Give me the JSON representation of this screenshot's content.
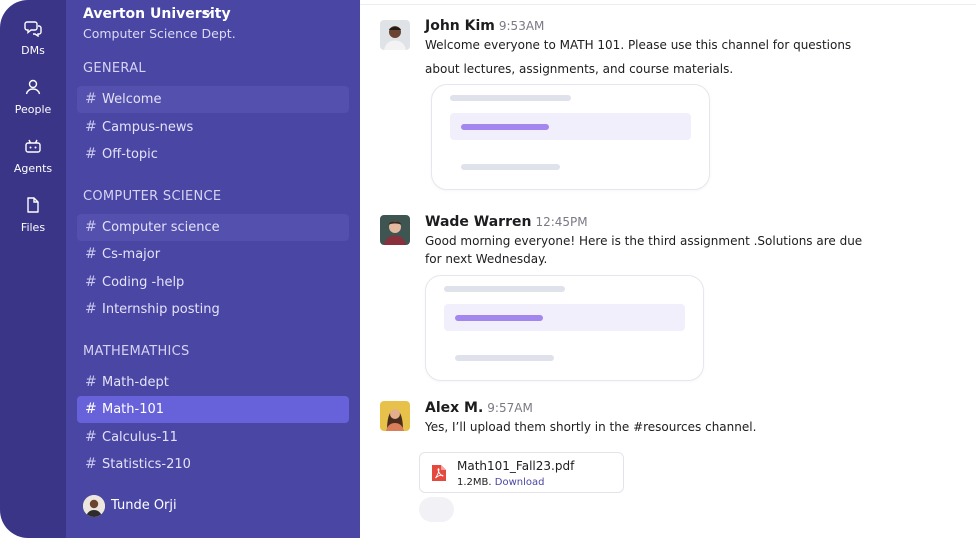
{
  "rail": {
    "items": [
      {
        "label": "DMs",
        "icon": "chat-bubbles-icon"
      },
      {
        "label": "People",
        "icon": "person-icon"
      },
      {
        "label": "Agents",
        "icon": "robot-icon"
      },
      {
        "label": "Files",
        "icon": "file-icon"
      }
    ]
  },
  "workspace": {
    "name": "Averton University",
    "subtitle": "Computer Science Dept."
  },
  "sections": [
    {
      "title": "GENERAL",
      "channels": [
        "Welcome",
        "Campus-news",
        "Off-topic"
      ]
    },
    {
      "title": "COMPUTER SCIENCE",
      "channels": [
        "Computer science",
        "Cs-major",
        "Coding -help",
        "Internship posting"
      ]
    },
    {
      "title": "MATHEMATHICS",
      "channels": [
        "Math-dept",
        "Math-101",
        "Calculus-11",
        "Statistics-210"
      ]
    }
  ],
  "active_channel": "Math-101",
  "current_user": {
    "name": "Tunde Orji"
  },
  "messages": [
    {
      "author": "John Kim",
      "time": "9:53AM",
      "lines": [
        "Welcome everyone to MATH 101. Please use this channel for questions",
        "about lectures, assignments, and course materials."
      ]
    },
    {
      "author": "Wade Warren",
      "time": "12:45PM",
      "lines": [
        "Good morning everyone! Here is the third assignment .Solutions are due",
        " for next Wednesday."
      ]
    },
    {
      "author": "Alex M.",
      "time": "9:57AM",
      "lines": [
        "Yes, I’ll upload them shortly in the #resources channel."
      ],
      "attachment": {
        "name": "Math101_Fall23.pdf",
        "size": "1.2MB.",
        "action": "Download"
      }
    }
  ],
  "colors": {
    "rail": "#3a3587",
    "sidebar": "#4a46a4",
    "active": "#6762d9",
    "accent": "#a386ee"
  }
}
